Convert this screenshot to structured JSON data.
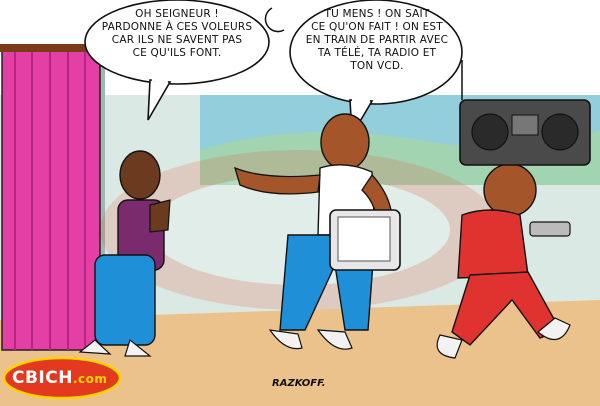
{
  "bubble_left": {
    "text": "OH SEIGNEUR !\nPARDONNE À CES VOLEURS\nCAR ILS NE SAVENT PAS\nCE QU'ILS FONT."
  },
  "bubble_right": {
    "text": "TU MENS ! ON SAIT\nCE QU'ON FAIT ! ON EST\nEN TRAIN DE PARTIR AVEC\nTA TÉLÉ, TA RADIO ET\nTON VCD."
  },
  "logo": {
    "main": "CBICH",
    "suffix": ".com"
  },
  "signature": "RAZKOFF.",
  "colors": {
    "sky": "#2eb2e6",
    "wall": "#c7ddd6",
    "ground": "#ecc28c",
    "curtain": "#e33fa5",
    "shirt_red": "#e0322e",
    "pants_blue": "#1f8fd8"
  }
}
